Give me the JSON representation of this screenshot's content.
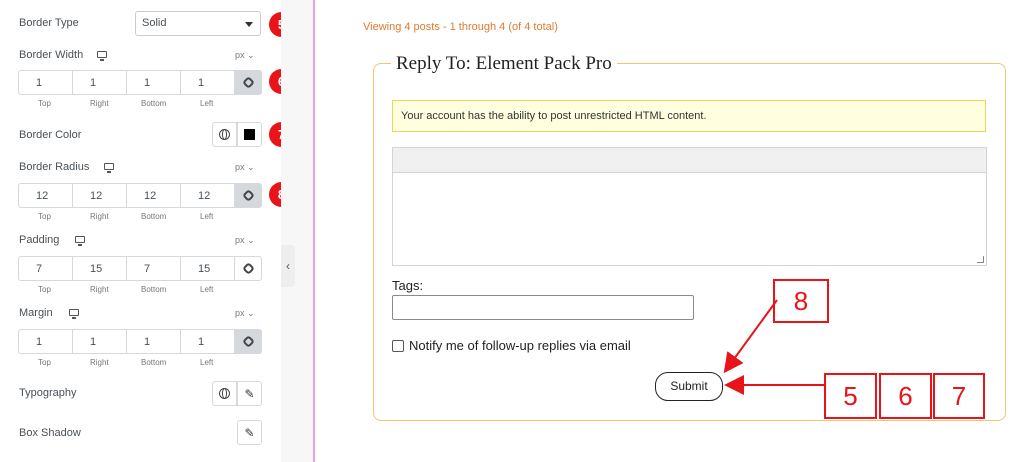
{
  "panel": {
    "border_type": {
      "label": "Border Type",
      "value": "Solid",
      "badge": "5"
    },
    "border_width": {
      "label": "Border Width",
      "unit": "px",
      "values": [
        "1",
        "1",
        "1",
        "1"
      ],
      "sides": [
        "Top",
        "Right",
        "Bottom",
        "Left"
      ],
      "badge": "6"
    },
    "border_color": {
      "label": "Border Color",
      "swatch_color": "#000000",
      "badge": "7"
    },
    "border_radius": {
      "label": "Border Radius",
      "unit": "px",
      "values": [
        "12",
        "12",
        "12",
        "12"
      ],
      "sides": [
        "Top",
        "Right",
        "Bottom",
        "Left"
      ],
      "badge": "8"
    },
    "padding": {
      "label": "Padding",
      "unit": "px",
      "values": [
        "7",
        "15",
        "7",
        "15"
      ],
      "sides": [
        "Top",
        "Right",
        "Bottom",
        "Left"
      ]
    },
    "margin": {
      "label": "Margin",
      "unit": "px",
      "values": [
        "1",
        "1",
        "1",
        "1"
      ],
      "sides": [
        "Top",
        "Right",
        "Bottom",
        "Left"
      ]
    },
    "typography": {
      "label": "Typography"
    },
    "box_shadow": {
      "label": "Box Shadow"
    }
  },
  "content": {
    "viewing": "Viewing 4 posts - 1 through 4 (of 4 total)",
    "legend": "Reply To: Element Pack Pro",
    "notice": "Your account has the ability to post unrestricted HTML content.",
    "tags_label": "Tags:",
    "notify_label": "Notify me of follow-up replies via email",
    "submit_label": "Submit"
  },
  "callouts": {
    "n8": "8",
    "n5": "5",
    "n6": "6",
    "n7": "7"
  },
  "colors": {
    "badge": "#e8141a",
    "accent": "#e07b2e",
    "fieldset_border": "#f0c674",
    "panel_divider": "#f29cf5"
  }
}
